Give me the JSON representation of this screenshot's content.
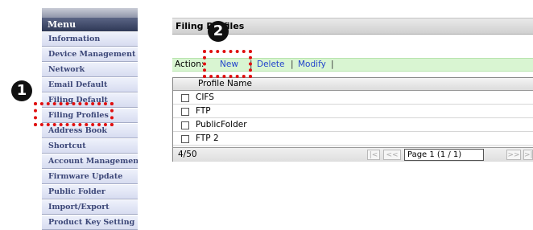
{
  "menu": {
    "header": "Menu",
    "items": [
      "Information",
      "Device Management",
      "Network",
      "Email Default",
      "Filing Default",
      "Filing Profiles",
      "Address Book",
      "Shortcut",
      "Account Management",
      "Firmware Update",
      "Public Folder",
      "Import/Export",
      "Product Key Setting"
    ]
  },
  "annotations": {
    "step1": "1",
    "step2": "2"
  },
  "page": {
    "title": "Filing Profiles"
  },
  "actions": {
    "label": "Action:",
    "new": "New",
    "delete": "Delete",
    "modify": "Modify",
    "separator": "|"
  },
  "table": {
    "column": "Profile Name",
    "rows": [
      "CIFS",
      "FTP",
      "PublicFolder",
      "FTP 2"
    ]
  },
  "pager": {
    "count": "4/50",
    "first": "|<",
    "prev": "<<",
    "page": "Page 1 (1 / 1)",
    "next": ">>",
    "last": ">|"
  },
  "colors": {
    "menu_header": "#2e3856",
    "menu_text": "#3c4778",
    "action_bar": "#d9f5d2",
    "link": "#2244cc",
    "highlight": "#e01010"
  }
}
